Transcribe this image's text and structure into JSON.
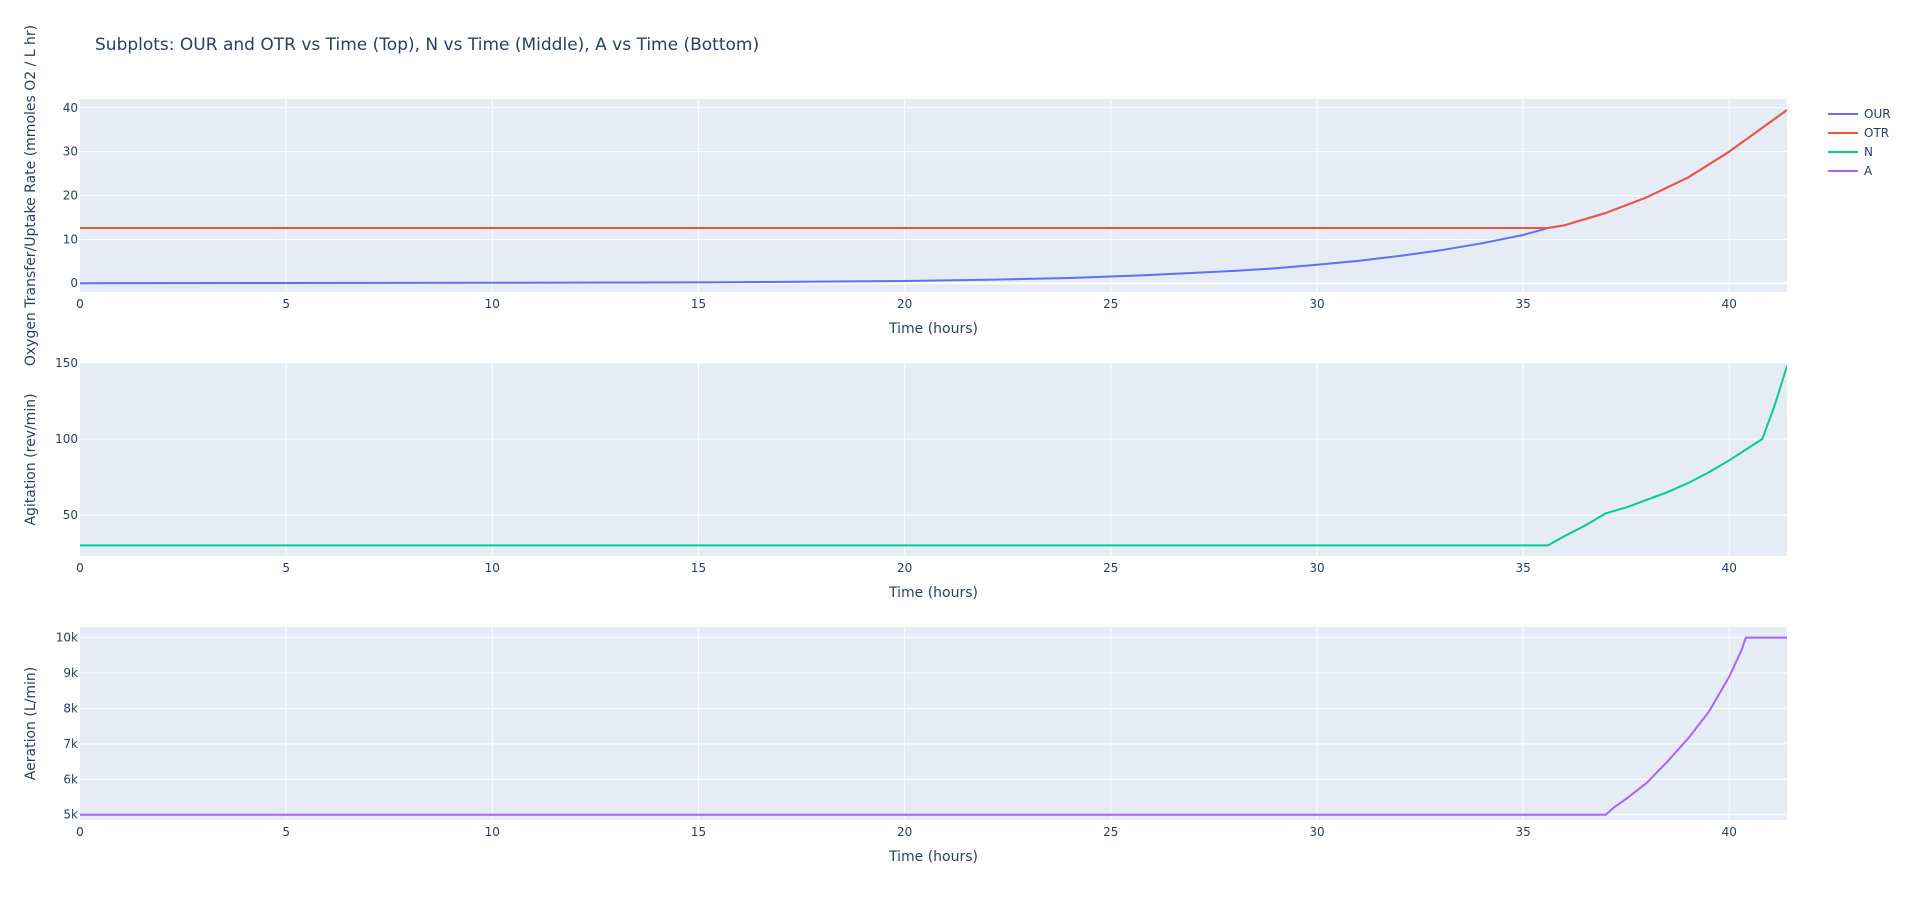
{
  "title": "Subplots: OUR and OTR vs Time (Top), N vs Time (Middle), A vs Time (Bottom)",
  "legend": [
    {
      "name": "OUR",
      "color": "#636efa"
    },
    {
      "name": "OTR",
      "color": "#EF553B"
    },
    {
      "name": "N",
      "color": "#00cc96"
    },
    {
      "name": "A",
      "color": "#ab63fa"
    }
  ],
  "chart_data": [
    {
      "type": "line",
      "title": "OUR and OTR vs Time",
      "xlabel": "Time (hours)",
      "ylabel": "Oxygen Transfer/Uptake Rate (mmoles O2 / L hr)",
      "xlim": [
        0,
        41.4
      ],
      "ylim": [
        -2,
        42
      ],
      "xticks": [
        "0",
        "5",
        "10",
        "15",
        "20",
        "25",
        "30",
        "35",
        "40"
      ],
      "yticks": [
        "0",
        "10",
        "20",
        "30",
        "40"
      ],
      "grid": true,
      "series": [
        {
          "name": "OUR",
          "color": "#636efa",
          "x": [
            0,
            5,
            10,
            15,
            20,
            22,
            24,
            26,
            28,
            29,
            30,
            31,
            32,
            33,
            34,
            35,
            35.6,
            36,
            37,
            38,
            39,
            40,
            41.4
          ],
          "y": [
            0,
            0.05,
            0.1,
            0.2,
            0.5,
            0.8,
            1.2,
            1.9,
            2.8,
            3.4,
            4.2,
            5.1,
            6.2,
            7.5,
            9.1,
            11.0,
            12.6,
            13.2,
            16.0,
            19.6,
            24.1,
            30.0,
            39.5
          ]
        },
        {
          "name": "OTR",
          "color": "#EF553B",
          "x": [
            0,
            5,
            10,
            15,
            20,
            25,
            30,
            35,
            35.6,
            36,
            37,
            38,
            39,
            40,
            41.4
          ],
          "y": [
            12.6,
            12.6,
            12.6,
            12.6,
            12.6,
            12.6,
            12.6,
            12.6,
            12.6,
            13.2,
            16.0,
            19.6,
            24.1,
            30.0,
            39.5
          ]
        }
      ]
    },
    {
      "type": "line",
      "title": "N vs Time",
      "xlabel": "Time (hours)",
      "ylabel": "Agitation (rev/min)",
      "xlim": [
        0,
        41.4
      ],
      "ylim": [
        23,
        150
      ],
      "xticks": [
        "0",
        "5",
        "10",
        "15",
        "20",
        "25",
        "30",
        "35",
        "40"
      ],
      "yticks": [
        "50",
        "100",
        "150"
      ],
      "grid": true,
      "series": [
        {
          "name": "N",
          "color": "#00cc96",
          "x": [
            0,
            5,
            10,
            15,
            20,
            25,
            30,
            35,
            35.6,
            36,
            36.5,
            37,
            37.5,
            38,
            38.5,
            39,
            39.5,
            40,
            40.4,
            40.8,
            41.1,
            41.4
          ],
          "y": [
            30,
            30,
            30,
            30,
            30,
            30,
            30,
            30,
            30,
            36,
            43,
            51,
            55,
            60,
            65,
            71,
            78,
            86,
            93,
            100,
            122,
            148
          ]
        }
      ]
    },
    {
      "type": "line",
      "title": "A vs Time",
      "xlabel": "Time (hours)",
      "ylabel": "Aeration (L/min)",
      "xlim": [
        0,
        41.4
      ],
      "ylim": [
        4850,
        10300
      ],
      "xticks": [
        "0",
        "5",
        "10",
        "15",
        "20",
        "25",
        "30",
        "35",
        "40"
      ],
      "yticks": [
        "5k",
        "6k",
        "7k",
        "8k",
        "9k",
        "10k"
      ],
      "grid": true,
      "series": [
        {
          "name": "A",
          "color": "#ab63fa",
          "x": [
            0,
            5,
            10,
            15,
            20,
            25,
            30,
            35,
            37,
            37.2,
            37.5,
            38,
            38.5,
            39,
            39.5,
            40,
            40.3,
            40.4,
            41.4
          ],
          "y": [
            5000,
            5000,
            5000,
            5000,
            5000,
            5000,
            5000,
            5000,
            5000,
            5200,
            5450,
            5900,
            6500,
            7150,
            7900,
            8900,
            9650,
            10000,
            10000
          ]
        }
      ]
    }
  ]
}
